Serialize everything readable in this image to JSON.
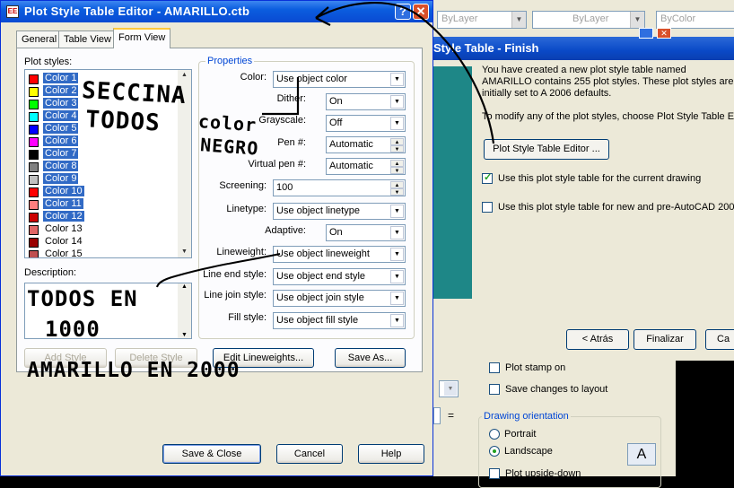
{
  "background": {
    "toolbar_combos": [
      "ByLayer",
      "ByLayer",
      "ByColor"
    ],
    "finish_dialog": {
      "title": "Style Table - Finish",
      "body": "You have created a new plot style table named AMARILLO contains 255 plot styles. These plot styles are initially set to A 2006 defaults.",
      "modify_text": "To modify any of the plot styles, choose Plot Style Table Edi",
      "editor_button": "Plot Style Table Editor ...",
      "check_current": "Use this plot style table for the current drawing",
      "check_new": "Use this plot style table for new and pre-AutoCAD 2006 d",
      "back_button": "< Atrás",
      "finish_button": "Finalizar",
      "cancel_button": "Ca"
    },
    "page_setup": {
      "plot_stamp": "Plot stamp on",
      "save_changes": "Save changes to layout",
      "orientation_legend": "Drawing orientation",
      "portrait": "Portrait",
      "landscape": "Landscape",
      "upside_down": "Plot upside-down",
      "orientation_icon_letter": "A",
      "equals_sign": "="
    }
  },
  "dialog": {
    "title": "Plot Style Table Editor - AMARILLO.ctb",
    "app_icon_text": "EE",
    "tabs": [
      "General",
      "Table View",
      "Form View"
    ],
    "active_tab": 2,
    "plot_styles_label": "Plot styles:",
    "plot_styles": [
      {
        "name": "Color 1",
        "color": "#ff0000",
        "selected": true
      },
      {
        "name": "Color 2",
        "color": "#ffff00",
        "selected": true
      },
      {
        "name": "Color 3",
        "color": "#00ff00",
        "selected": true
      },
      {
        "name": "Color 4",
        "color": "#00ffff",
        "selected": true
      },
      {
        "name": "Color 5",
        "color": "#0000ff",
        "selected": true
      },
      {
        "name": "Color 6",
        "color": "#ff00ff",
        "selected": true
      },
      {
        "name": "Color 7",
        "color": "#000000",
        "selected": true
      },
      {
        "name": "Color 8",
        "color": "#808080",
        "selected": true
      },
      {
        "name": "Color 9",
        "color": "#c0c0c0",
        "selected": true
      },
      {
        "name": "Color 10",
        "color": "#ff0000",
        "selected": true
      },
      {
        "name": "Color 11",
        "color": "#ff7f7f",
        "selected": true
      },
      {
        "name": "Color 12",
        "color": "#cc0000",
        "selected": true
      },
      {
        "name": "Color 13",
        "color": "#e06666",
        "selected": false
      },
      {
        "name": "Color 14",
        "color": "#990000",
        "selected": false
      },
      {
        "name": "Color 15",
        "color": "#c05050",
        "selected": false
      }
    ],
    "description_label": "Description:",
    "properties_legend": "Properties",
    "properties": {
      "color": {
        "label": "Color:",
        "value": "Use object color"
      },
      "dither": {
        "label": "Dither:",
        "value": "On"
      },
      "grayscale": {
        "label": "Grayscale:",
        "value": "Off"
      },
      "pen": {
        "label": "Pen #:",
        "value": "Automatic"
      },
      "virtual_pen": {
        "label": "Virtual pen #:",
        "value": "Automatic"
      },
      "screening": {
        "label": "Screening:",
        "value": "100"
      },
      "linetype": {
        "label": "Linetype:",
        "value": "Use object linetype"
      },
      "adaptive": {
        "label": "Adaptive:",
        "value": "On"
      },
      "lineweight": {
        "label": "Lineweight:",
        "value": "Use object lineweight"
      },
      "line_end": {
        "label": "Line end style:",
        "value": "Use object end style"
      },
      "line_join": {
        "label": "Line join style:",
        "value": "Use object join style"
      },
      "fill": {
        "label": "Fill style:",
        "value": "Use object fill style"
      }
    },
    "buttons": {
      "add_style": "Add Style",
      "delete_style": "Delete Style",
      "edit_lineweights": "Edit Lineweights...",
      "save_as": "Save As...",
      "save_close": "Save & Close",
      "cancel": "Cancel",
      "help": "Help"
    }
  },
  "annotations": {
    "select_all": [
      "SECCINA",
      "TODOS"
    ],
    "color_black": [
      "color",
      "NEGRO"
    ],
    "all_in": [
      "TODOS EN",
      "1000"
    ],
    "yellow_in": "AMARILLO EN 2000"
  }
}
